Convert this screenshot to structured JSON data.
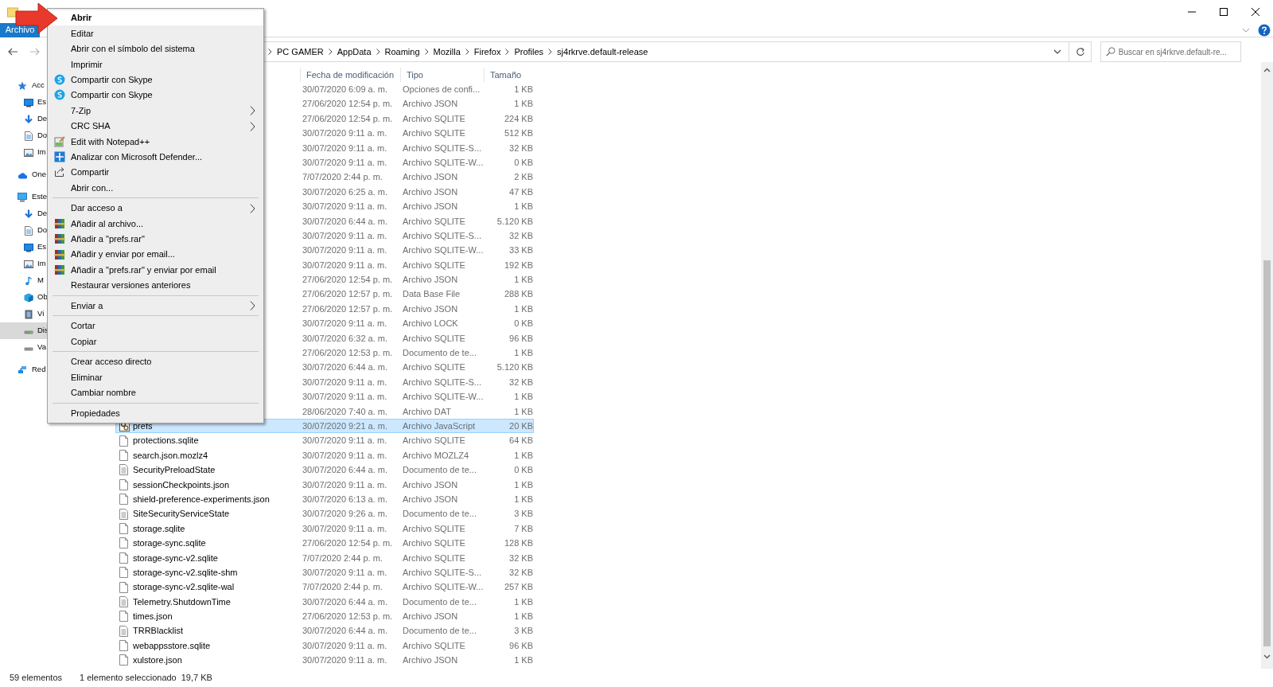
{
  "pointer_arrow": {
    "kind": "arrow"
  },
  "ribbon": {
    "tabs": [
      {
        "label": "Archivo",
        "selected": true
      }
    ]
  },
  "navigation": [
    {
      "kind": "back",
      "disabled": false
    },
    {
      "kind": "forward",
      "disabled": true
    }
  ],
  "address_bar": {
    "breadcrumbs": [
      "PC GAMER",
      "AppData",
      "Roaming",
      "Mozilla",
      "Firefox",
      "Profiles",
      "sj4rkrve.default-release"
    ]
  },
  "search": {
    "placeholder": "Buscar en sj4rkrve.default-re..."
  },
  "sidebar": {
    "items": [
      {
        "label": "Acc",
        "kind": "star",
        "selected": false,
        "children": [
          {
            "label": "Es",
            "kind": "desktop",
            "selected": false
          },
          {
            "label": "De",
            "kind": "download",
            "selected": false
          },
          {
            "label": "Do",
            "kind": "document",
            "selected": false
          },
          {
            "label": "Im",
            "kind": "image",
            "selected": false
          }
        ]
      },
      {
        "label": "One",
        "kind": "cloud",
        "selected": false
      },
      {
        "label": "Este",
        "kind": "computer",
        "selected": false,
        "children": [
          {
            "label": "De",
            "kind": "download",
            "selected": false
          },
          {
            "label": "Do",
            "kind": "document",
            "selected": false
          },
          {
            "label": "Es",
            "kind": "desktop",
            "selected": false
          },
          {
            "label": "Im",
            "kind": "image",
            "selected": false
          },
          {
            "label": "M",
            "kind": "music",
            "selected": false
          },
          {
            "label": "Ob",
            "kind": "cube",
            "selected": false
          },
          {
            "label": "Vi",
            "kind": "film",
            "selected": false
          },
          {
            "label": "Dis",
            "kind": "drive",
            "selected": true
          },
          {
            "label": "Va",
            "kind": "drive",
            "selected": false
          }
        ]
      },
      {
        "label": "Red",
        "kind": "network",
        "selected": false
      }
    ]
  },
  "file_list": {
    "columns": [
      "Fecha de modificación",
      "Tipo",
      "Tamaño"
    ],
    "rows": [
      {
        "date": "30/07/2020 6:09 a. m.",
        "type": "Opciones de confi...",
        "size": "1 KB",
        "selected": false
      },
      {
        "date": "27/06/2020 12:54 p. m.",
        "type": "Archivo JSON",
        "size": "1 KB",
        "selected": false
      },
      {
        "date": "27/06/2020 12:54 p. m.",
        "type": "Archivo SQLITE",
        "size": "224 KB",
        "selected": false
      },
      {
        "date": "30/07/2020 9:11 a. m.",
        "type": "Archivo SQLITE",
        "size": "512 KB",
        "selected": false
      },
      {
        "date": "30/07/2020 9:11 a. m.",
        "type": "Archivo SQLITE-S...",
        "size": "32 KB",
        "selected": false
      },
      {
        "date": "30/07/2020 9:11 a. m.",
        "type": "Archivo SQLITE-W...",
        "size": "0 KB",
        "selected": false
      },
      {
        "date": "7/07/2020 2:44 p. m.",
        "type": "Archivo JSON",
        "size": "2 KB",
        "selected": false
      },
      {
        "date": "30/07/2020 6:25 a. m.",
        "type": "Archivo JSON",
        "size": "47 KB",
        "selected": false
      },
      {
        "date": "30/07/2020 9:11 a. m.",
        "type": "Archivo JSON",
        "size": "1 KB",
        "selected": false
      },
      {
        "date": "30/07/2020 6:44 a. m.",
        "type": "Archivo SQLITE",
        "size": "5.120 KB",
        "selected": false
      },
      {
        "date": "30/07/2020 9:11 a. m.",
        "type": "Archivo SQLITE-S...",
        "size": "32 KB",
        "selected": false
      },
      {
        "date": "30/07/2020 9:11 a. m.",
        "type": "Archivo SQLITE-W...",
        "size": "33 KB",
        "selected": false
      },
      {
        "date": "30/07/2020 9:11 a. m.",
        "type": "Archivo SQLITE",
        "size": "192 KB",
        "selected": false
      },
      {
        "date": "27/06/2020 12:54 p. m.",
        "type": "Archivo JSON",
        "size": "1 KB",
        "selected": false
      },
      {
        "date": "27/06/2020 12:57 p. m.",
        "type": "Data Base File",
        "size": "288 KB",
        "selected": false
      },
      {
        "date": "27/06/2020 12:57 p. m.",
        "type": "Archivo JSON",
        "size": "1 KB",
        "selected": false
      },
      {
        "date": "30/07/2020 9:11 a. m.",
        "type": "Archivo LOCK",
        "size": "0 KB",
        "selected": false
      },
      {
        "date": "30/07/2020 6:32 a. m.",
        "type": "Archivo SQLITE",
        "size": "96 KB",
        "selected": false
      },
      {
        "date": "27/06/2020 12:53 p. m.",
        "type": "Documento de te...",
        "size": "1 KB",
        "selected": false
      },
      {
        "date": "30/07/2020 6:44 a. m.",
        "type": "Archivo SQLITE",
        "size": "5.120 KB",
        "selected": false
      },
      {
        "date": "30/07/2020 9:11 a. m.",
        "type": "Archivo SQLITE-S...",
        "size": "32 KB",
        "selected": false
      },
      {
        "date": "30/07/2020 9:11 a. m.",
        "type": "Archivo SQLITE-W...",
        "size": "1 KB",
        "selected": false
      },
      {
        "date": "28/06/2020 7:40 a. m.",
        "type": "Archivo DAT",
        "size": "1 KB",
        "selected": false
      },
      {
        "name": "prefs",
        "kind": "script",
        "date": "30/07/2020 9:21 a. m.",
        "type": "Archivo JavaScript",
        "size": "20 KB",
        "selected": true
      },
      {
        "name": "protections.sqlite",
        "kind": "blank",
        "date": "30/07/2020 9:11 a. m.",
        "type": "Archivo SQLITE",
        "size": "64 KB",
        "selected": false
      },
      {
        "name": "search.json.mozlz4",
        "kind": "blank",
        "date": "30/07/2020 9:11 a. m.",
        "type": "Archivo MOZLZ4",
        "size": "1 KB",
        "selected": false
      },
      {
        "name": "SecurityPreloadState",
        "kind": "text",
        "date": "30/07/2020 6:44 a. m.",
        "type": "Documento de te...",
        "size": "0 KB",
        "selected": false
      },
      {
        "name": "sessionCheckpoints.json",
        "kind": "blank",
        "date": "30/07/2020 9:11 a. m.",
        "type": "Archivo JSON",
        "size": "1 KB",
        "selected": false
      },
      {
        "name": "shield-preference-experiments.json",
        "kind": "blank",
        "date": "30/07/2020 6:13 a. m.",
        "type": "Archivo JSON",
        "size": "1 KB",
        "selected": false
      },
      {
        "name": "SiteSecurityServiceState",
        "kind": "text",
        "date": "30/07/2020 9:26 a. m.",
        "type": "Documento de te...",
        "size": "3 KB",
        "selected": false
      },
      {
        "name": "storage.sqlite",
        "kind": "blank",
        "date": "30/07/2020 9:11 a. m.",
        "type": "Archivo SQLITE",
        "size": "7 KB",
        "selected": false
      },
      {
        "name": "storage-sync.sqlite",
        "kind": "blank",
        "date": "27/06/2020 12:54 p. m.",
        "type": "Archivo SQLITE",
        "size": "128 KB",
        "selected": false
      },
      {
        "name": "storage-sync-v2.sqlite",
        "kind": "blank",
        "date": "7/07/2020 2:44 p. m.",
        "type": "Archivo SQLITE",
        "size": "32 KB",
        "selected": false
      },
      {
        "name": "storage-sync-v2.sqlite-shm",
        "kind": "blank",
        "date": "30/07/2020 9:11 a. m.",
        "type": "Archivo SQLITE-S...",
        "size": "32 KB",
        "selected": false
      },
      {
        "name": "storage-sync-v2.sqlite-wal",
        "kind": "blank",
        "date": "7/07/2020 2:44 p. m.",
        "type": "Archivo SQLITE-W...",
        "size": "257 KB",
        "selected": false
      },
      {
        "name": "Telemetry.ShutdownTime",
        "kind": "text",
        "date": "30/07/2020 6:44 a. m.",
        "type": "Documento de te...",
        "size": "1 KB",
        "selected": false
      },
      {
        "name": "times.json",
        "kind": "blank",
        "date": "27/06/2020 12:53 p. m.",
        "type": "Archivo JSON",
        "size": "1 KB",
        "selected": false
      },
      {
        "name": "TRRBlacklist",
        "kind": "text",
        "date": "30/07/2020 6:44 a. m.",
        "type": "Documento de te...",
        "size": "3 KB",
        "selected": false
      },
      {
        "name": "webappsstore.sqlite",
        "kind": "blank",
        "date": "30/07/2020 9:11 a. m.",
        "type": "Archivo SQLITE",
        "size": "96 KB",
        "selected": false
      },
      {
        "name": "xulstore.json",
        "kind": "blank",
        "date": "30/07/2020 9:11 a. m.",
        "type": "Archivo JSON",
        "size": "1 KB",
        "selected": false
      }
    ]
  },
  "context_menu": {
    "items": [
      {
        "kind": "item",
        "label": "Abrir",
        "bold": true,
        "highlighted": true,
        "submenu": false
      },
      {
        "kind": "item",
        "label": "Editar",
        "bold": false,
        "highlighted": false,
        "submenu": false
      },
      {
        "kind": "item",
        "label": "Abrir con el símbolo del sistema",
        "bold": false,
        "highlighted": false,
        "submenu": false
      },
      {
        "kind": "item",
        "label": "Imprimir",
        "bold": false,
        "highlighted": false,
        "submenu": false
      },
      {
        "kind": "item",
        "label": "Compartir con Skype",
        "bold": false,
        "highlighted": false,
        "submenu": false
      },
      {
        "kind": "item",
        "label": "Compartir con Skype",
        "bold": false,
        "highlighted": false,
        "submenu": false
      },
      {
        "kind": "item",
        "label": "7-Zip",
        "bold": false,
        "highlighted": false,
        "submenu": true
      },
      {
        "kind": "item",
        "label": "CRC SHA",
        "bold": false,
        "highlighted": false,
        "submenu": true
      },
      {
        "kind": "item",
        "label": "Edit with Notepad++",
        "bold": false,
        "highlighted": false,
        "submenu": false
      },
      {
        "kind": "item",
        "label": "Analizar con Microsoft Defender...",
        "bold": false,
        "highlighted": false,
        "submenu": false
      },
      {
        "kind": "item",
        "label": "Compartir",
        "bold": false,
        "highlighted": false,
        "submenu": false
      },
      {
        "kind": "item",
        "label": "Abrir con...",
        "bold": false,
        "highlighted": false,
        "submenu": false
      },
      {
        "kind": "separator"
      },
      {
        "kind": "item",
        "label": "Dar acceso a",
        "bold": false,
        "highlighted": false,
        "submenu": true
      },
      {
        "kind": "item",
        "label": "Añadir al archivo...",
        "bold": false,
        "highlighted": false,
        "submenu": false
      },
      {
        "kind": "item",
        "label": "Añadir a \"prefs.rar\"",
        "bold": false,
        "highlighted": false,
        "submenu": false
      },
      {
        "kind": "item",
        "label": "Añadir y enviar por email...",
        "bold": false,
        "highlighted": false,
        "submenu": false
      },
      {
        "kind": "item",
        "label": "Añadir a \"prefs.rar\" y enviar por email",
        "bold": false,
        "highlighted": false,
        "submenu": false
      },
      {
        "kind": "item",
        "label": "Restaurar versiones anteriores",
        "bold": false,
        "highlighted": false,
        "submenu": false
      },
      {
        "kind": "separator"
      },
      {
        "kind": "item",
        "label": "Enviar a",
        "bold": false,
        "highlighted": false,
        "submenu": true
      },
      {
        "kind": "separator"
      },
      {
        "kind": "item",
        "label": "Cortar",
        "bold": false,
        "highlighted": false,
        "submenu": false
      },
      {
        "kind": "item",
        "label": "Copiar",
        "bold": false,
        "highlighted": false,
        "submenu": false
      },
      {
        "kind": "separator"
      },
      {
        "kind": "item",
        "label": "Crear acceso directo",
        "bold": false,
        "highlighted": false,
        "submenu": false
      },
      {
        "kind": "item",
        "label": "Eliminar",
        "bold": false,
        "highlighted": false,
        "submenu": false
      },
      {
        "kind": "item",
        "label": "Cambiar nombre",
        "bold": false,
        "highlighted": false,
        "submenu": false
      },
      {
        "kind": "separator"
      },
      {
        "kind": "item",
        "label": "Propiedades",
        "bold": false,
        "highlighted": false,
        "submenu": false
      }
    ]
  },
  "status_bar": {
    "item_count": "59 elementos",
    "selection": "1 elemento seleccionado",
    "selection_size": "19,7 KB"
  }
}
